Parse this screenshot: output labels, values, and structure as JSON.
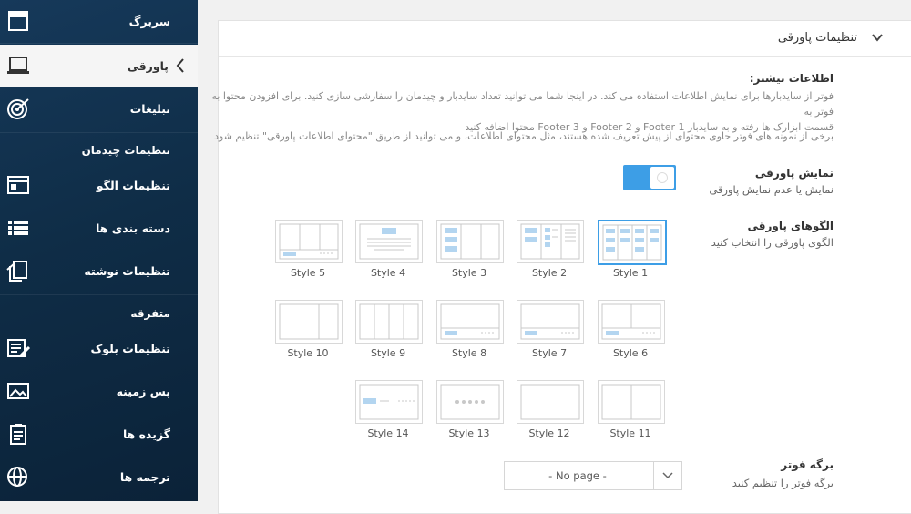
{
  "sidebar": {
    "items": [
      {
        "label": "سربرگ",
        "icon": "header-layout-icon"
      },
      {
        "label": "پاورقی",
        "icon": "laptop-icon"
      },
      {
        "label": "تبلیغات",
        "icon": "target-icon"
      },
      {
        "label": "تنظیمات الگو",
        "icon": "browser-window-icon"
      },
      {
        "label": "دسته بندی ها",
        "icon": "list-icon"
      },
      {
        "label": "تنظیمات نوشته",
        "icon": "copy-post-icon"
      },
      {
        "label": "تنظیمات بلوک",
        "icon": "block-edit-icon"
      },
      {
        "label": "پس زمینه",
        "icon": "image-icon"
      },
      {
        "label": "گزیده ها",
        "icon": "clipboard-icon"
      },
      {
        "label": "ترجمه ها",
        "icon": "globe-icon"
      }
    ],
    "section_layout": "تنظیمات چیدمان",
    "section_misc": "متفرقه"
  },
  "panel": {
    "title": "تنظیمات پاورقی",
    "more_info_title": "اطلاعات بیشتر:",
    "desc_line1": "فوتر از سایدبارها برای نمایش اطلاعات استفاده می کند. در اینجا شما می توانید تعداد سایدبار و چیدمان را سفارشی سازی کنید. برای افزودن محتوا به فوتر به",
    "desc_line2": "قسمت ابزارک ها رفته و به سایدبار Footer 1 و Footer 2 و Footer 3 محتوا اضافه کنید",
    "desc_line3": "برخی از نمونه های فوتر حاوی محتوای از پیش تعریف شده هستند، مثل محتوای اطلاعات، و می توانید از طریق \"محتوای اطلاعات پاورقی\" تنظیم شود",
    "show_footer_title": "نمایش پاورقی",
    "show_footer_desc": "نمایش یا عدم نمایش پاورقی",
    "show_footer_on": true,
    "patterns_title": "الگوهای پاورقی",
    "patterns_desc": "الگوی پاورقی را انتخاب کنید",
    "styles": [
      "Style 1",
      "Style 2",
      "Style 3",
      "Style 4",
      "Style 5",
      "Style 6",
      "Style 7",
      "Style 8",
      "Style 9",
      "Style 10",
      "Style 11",
      "Style 12",
      "Style 13",
      "Style 14"
    ],
    "selected_style": "Style 1",
    "footer_page_title": "برگه فوتر",
    "footer_page_desc": "برگه فوتر را تنظیم کنید",
    "footer_page_value": "- No page -"
  },
  "colors": {
    "accent": "#3d9ee6",
    "sidebar_bg": "#0f2d47",
    "thumb_fill": "#b3d5f0",
    "thumb_line": "#c8c8c8"
  }
}
